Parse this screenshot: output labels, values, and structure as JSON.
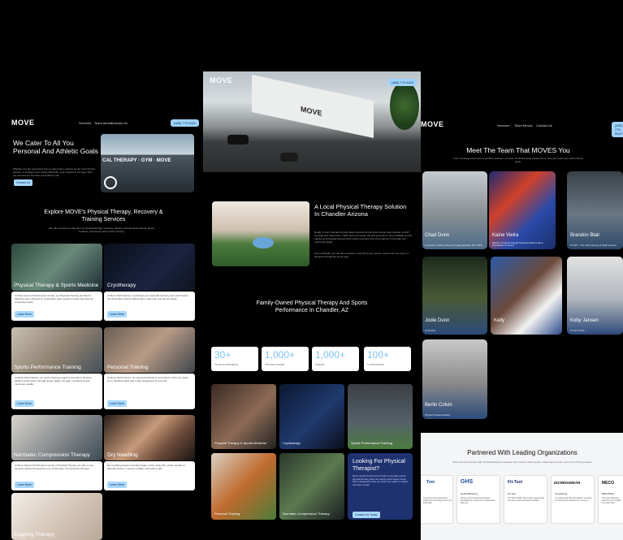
{
  "left": {
    "logo": "MOVE",
    "nav": [
      "Services",
      "Team Moves",
      "Contact Us"
    ],
    "phone": "(480) 779-5422",
    "hero_title": "We Cater To All You Personal And Athletic Goals",
    "hero_sub": "Whether you are recovering from a major injury, training for the next Olympic Games, or looking to live a less painful life, your success is our goal. With our services we can help you achieve it all.",
    "hero_cta": "Contact Us",
    "hero_sign": "CAL THERAPY · GYM · MOVE",
    "section_title": "Explore MOVE's Physical Therapy, Recovery & Training Services",
    "section_sub": "We offer a local one-stop spot for physical therapy, recovery, athletic, and personal training, sports medicine, and sports performance training.",
    "services": [
      {
        "title": "Physical Therapy & Sports Medicine",
        "desc": "At Move Human Performance Center, our Physical Therapy and Sports Medicine team will work to understand each person's needs and treat the underlying cause.",
        "cta": "Learn More"
      },
      {
        "title": "Cryotherapy",
        "desc": "At Move Performance, cryotherapy is a powerful recovery and performance tool that helps reduce inflammation, ease pain and recover faster.",
        "cta": "Learn More"
      },
      {
        "title": "Sports Performance Training",
        "desc": "At Move Performance, our sports training programs are built to develop athletic performance through speed, agility, strength, conditioning and movement quality.",
        "cta": "Learn More"
      },
      {
        "title": "Personal Training",
        "desc": "At Move Performance, our personal training is committed to help you reach your individual goals with a plan designed to fit your life.",
        "cta": "Learn More"
      },
      {
        "title": "Normatec Compression Therapy",
        "desc": "At Move Human Performance Center & Physical Therapy, we offer a new recovery solution through the use of Normatec Compression Therapy.",
        "cta": "Learn More"
      },
      {
        "title": "Dry Needling",
        "desc": "Dry needling targets muscular trigger points using thin, sterile needles to alleviate tension, improve mobility, and reduce pain.",
        "cta": "Learn More"
      },
      {
        "title": "Cupping Therapy",
        "desc": "",
        "cta": ""
      }
    ]
  },
  "mid": {
    "logo": "MOVE",
    "phone": "(480) 779-5422",
    "building_sign": "MOVE",
    "title": "A Local Physical Therapy Solution In Chandler Arizona",
    "body": "Ready to visit Chandler Arizona Move Human Performance Center was founded in 2017 by Chad and Justin Dunn. With local community, the first goal was to help establish a local training and physical therapy clinic where everyone from the beginner to the elite can reach their goals.",
    "body2": "Here at MOVE, you will have access to everything you need to recover from an injury or advance through life at any age.",
    "family_title": "Family-Owned Physical Therapy And Sports Performance In Chandler, AZ",
    "stats": [
      {
        "value": "30+",
        "label": "Years of Experience"
      },
      {
        "value": "1,000+",
        "label": "Athletes Trained"
      },
      {
        "value": "1,000+",
        "label": "Patients"
      },
      {
        "value": "100+",
        "label": "5 Star Reviews"
      }
    ],
    "tiles": [
      "Physical Therapy & Sports Medicine",
      "Cryotherapy",
      "Sports Performance Training",
      "Personal Training",
      "Normatec Compression Therapy"
    ],
    "looking_title": "Looking For Physical Therapist?",
    "looking_body": "Move Human Performance Center is a locally owned physical therapy clinic and sports performance center that is designed to help you reach your goals no matter how big or small.",
    "looking_cta": "Contact Us Today"
  },
  "right": {
    "logo": "MOVE",
    "nav": [
      "Services",
      "Team Moves",
      "Contact Us"
    ],
    "phone": "(480) 779-5422",
    "team_title": "Meet The Team That MOVES You",
    "team_sub": "From concierge-level care to certified coaches, our team combines deep experience to help you reach your performance goals.",
    "team": [
      {
        "name": "Chad Dunn",
        "role": "Co-Founder of Move & Physical Therapy Specialist, DPT, CSCS"
      },
      {
        "name": "Kaine Vieira",
        "role": "Bachelor of Science Strength Training & Wellness with a Specialization in Fitness"
      },
      {
        "name": "Brandon Blair",
        "role": "PT, DPT — B.S. ASU University of Health Sciences"
      },
      {
        "name": "Jodie Dunn",
        "role": "Co-Founder"
      },
      {
        "name": "Kelly",
        "role": ""
      },
      {
        "name": "Koby Jansen",
        "role": "PT, DPT, CSCS"
      },
      {
        "name": "Berlin Colvin",
        "role": "Physical Therapist Assistant"
      }
    ],
    "partners_title": "Partnered With Leading Organizations",
    "partners_sub": "We're proud to partner with focused thinking companies who invest in their people, value injured return, and a fun of living impact.",
    "partners": [
      {
        "logo": "Tom",
        "name": "",
        "desc": "Long-term brand recovering, training and providing care to the local area."
      },
      {
        "logo": "GHS",
        "name": "GHS Marketing",
        "desc": "We are a local marketing company specializing in senior home replacement and care."
      },
      {
        "logo": "Fit-Tool",
        "name": "Fit-Tool",
        "desc": "FIT-TOOL DRIFT ball a heat mapped body tool with a patented textured surface."
      },
      {
        "logo": "INCREDIWEAR",
        "name": "Incrediwear",
        "desc": "In a partnership with Incrediwear, a therapy is a clothing line allowing for a recovery."
      },
      {
        "logo": "MECO",
        "name": "MECOTEC",
        "desc": "This is an ideal first-hand for cryo modality in a team clinic."
      }
    ]
  },
  "colors": {
    "background": "#000000",
    "accent": "#a8d8ff",
    "card": "#ffffff",
    "overlay_blue": "#1e3a8a"
  }
}
